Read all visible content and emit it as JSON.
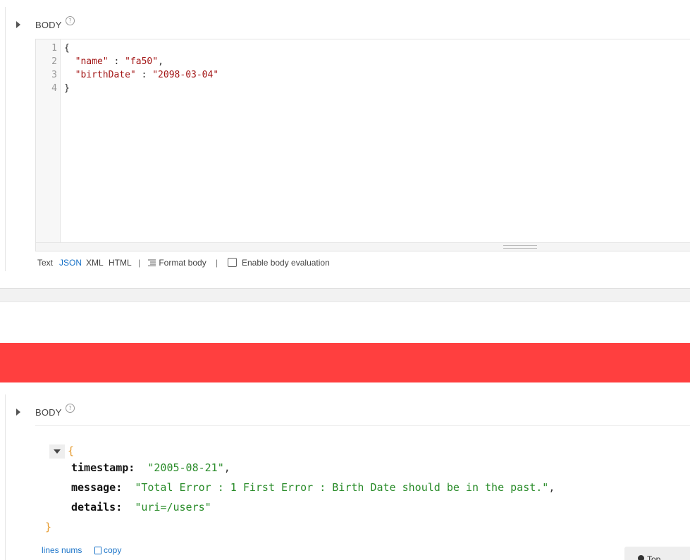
{
  "request": {
    "section_label": "BODY",
    "help_glyph": "?",
    "line_numbers": [
      "1",
      "2",
      "3",
      "4"
    ],
    "code": {
      "line1": "{",
      "name_key": "\"name\"",
      "name_val": "\"fa50\"",
      "birth_key": "\"birthDate\"",
      "birth_val": "\"2098-03-04\"",
      "line4": "}",
      "colon": " : ",
      "comma": ","
    },
    "format_bar": {
      "text": "Text",
      "json": "JSON",
      "xml": "XML",
      "html": "HTML",
      "separator": "|",
      "format_body": "Format body",
      "enable_eval": "Enable body evaluation"
    }
  },
  "response": {
    "section_label": "BODY",
    "help_glyph": "?",
    "open_brace": "{",
    "close_brace": "}",
    "fields": [
      {
        "key": "timestamp:",
        "value": "\"2005-08-21\"",
        "comma": ","
      },
      {
        "key": "message:",
        "value": "\"Total Error : 1 First Error : Birth Date should be in the past.\"",
        "comma": ","
      },
      {
        "key": "details:",
        "value": "\"uri=/users\"",
        "comma": ""
      }
    ],
    "lines_nums_link": "lines nums",
    "copy_link": "copy",
    "top_button": "Top"
  },
  "colors": {
    "error_bar": "#ff3f3f",
    "link": "#1a73c8",
    "json_string": "#2a8c2a",
    "json_brace": "#e69a2e"
  },
  "icons": [
    "expand-arrow-icon",
    "help-icon",
    "format-lines-icon",
    "checkbox",
    "collapse-arrow-icon",
    "copy-icon",
    "up-arrow-icon"
  ]
}
